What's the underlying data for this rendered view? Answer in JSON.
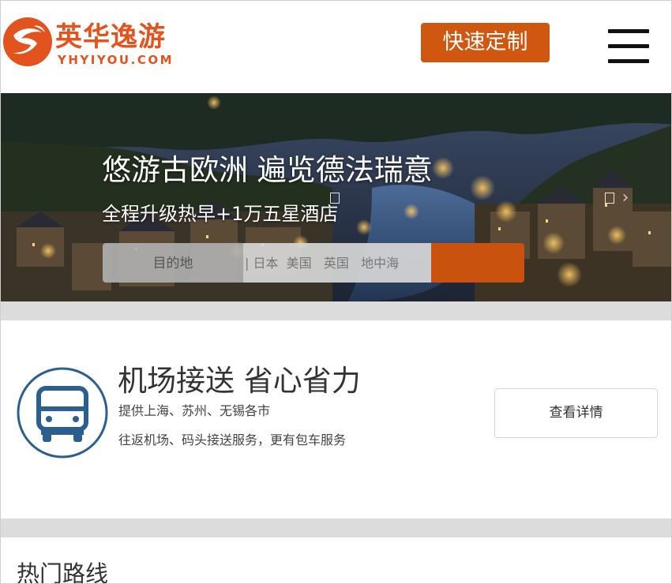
{
  "header": {
    "logo_cn": "英华逸游",
    "logo_en": "YHYIYOU.COM",
    "quick_custom_label": "快速定制"
  },
  "banner": {
    "title": "悠游古欧洲 遍览德法瑞意",
    "subtitle": "全程升级热早+1万五星酒店",
    "search": {
      "destination_label": "目的地",
      "placeholder": "| 日本  美国   英国   地中海"
    }
  },
  "feature": {
    "title": "机场接送  省心省力",
    "line1": "提供上海、苏州、无锡各市",
    "line2": "往返机场、码头接送服务，更有包车服务",
    "detail_label": "查看详情",
    "icon": "bus-icon",
    "icon_color": "#2b5f8f"
  },
  "hot_routes": {
    "title": "热门路线"
  },
  "colors": {
    "brand": "#e2531d",
    "button": "#d0570f",
    "divider": "#dcdcdc"
  }
}
